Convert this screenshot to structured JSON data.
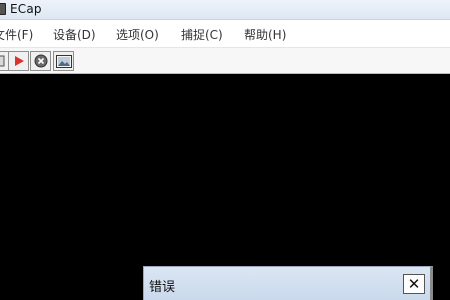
{
  "window": {
    "title": "ECap",
    "icon": "app-icon"
  },
  "menu": {
    "items": [
      "文件(F)",
      "设备(D)",
      "选项(O)",
      "捕捉(C)",
      "帮助(H)"
    ]
  },
  "toolbar": {
    "buttons": [
      {
        "icon": "capture-window-icon"
      },
      {
        "icon": "play-icon"
      },
      {
        "icon": "stop-icon"
      },
      {
        "icon": "snapshot-icon"
      }
    ],
    "colors": {
      "play": "#d9342b",
      "stop": "#555555"
    }
  },
  "dialog": {
    "title": "错误",
    "close_label": "✕"
  }
}
